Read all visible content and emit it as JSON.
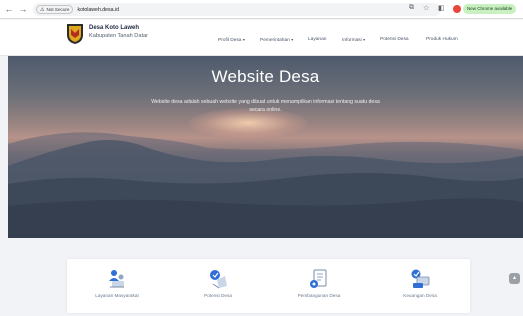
{
  "browser": {
    "back": "←",
    "forward": "→",
    "reload": "C",
    "not_secure": "Not Secure",
    "url": "kotolaweh.desa.id",
    "new_chrome": "New Chrome available"
  },
  "site": {
    "name": "Desa Koto Laweh",
    "subtitle": "Kabupaten Tanah Datar",
    "menu": [
      {
        "label": "Profil Desa",
        "caret": "▾"
      },
      {
        "label": "Pemerintahan",
        "caret": "▾"
      },
      {
        "label": "Layanan",
        "caret": ""
      },
      {
        "label": "Informasi",
        "caret": "▾"
      },
      {
        "label": "Potensi Desa",
        "caret": ""
      },
      {
        "label": "Produk Hukum",
        "caret": ""
      }
    ]
  },
  "hero": {
    "title": "Website Desa",
    "description": "Website desa adalah sebuah website yang dibuat untuk menampilkan informasi tentang suatu desa secara online."
  },
  "features": [
    {
      "label": "Layanan Masyarakat",
      "icon": "community-service-icon"
    },
    {
      "label": "Potensi Desa",
      "icon": "village-potential-icon"
    },
    {
      "label": "Pembangunan Desa",
      "icon": "village-development-icon"
    },
    {
      "label": "Keuangan Desa",
      "icon": "village-finance-icon"
    }
  ],
  "colors": {
    "accent": "#2f6fd6",
    "header_bg": "#ffffff",
    "page_bg": "#f1f3f6"
  }
}
